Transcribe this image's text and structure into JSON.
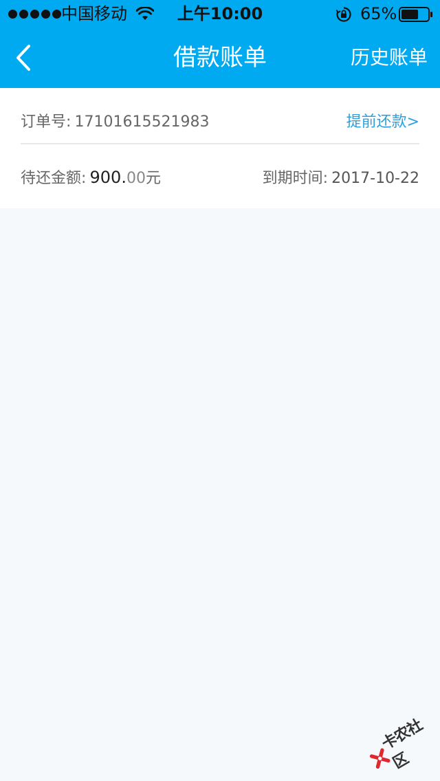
{
  "status_bar": {
    "carrier": "中国移动",
    "time": "上午10:00",
    "battery_percent": "65%",
    "battery_level": 0.65,
    "icons": [
      "signal-dots",
      "wifi-icon",
      "rotation-lock-icon",
      "battery-icon"
    ]
  },
  "nav": {
    "back_icon": "chevron-left-icon",
    "title": "借款账单",
    "history_label": "历史账单"
  },
  "bill": {
    "order_label": "订单号:",
    "order_number": "17101615521983",
    "prepay_label": "提前还款>",
    "amount_label": "待还金额:",
    "amount_integer": "900.",
    "amount_decimal": "00",
    "amount_unit": "元",
    "due_label": "到期时间:",
    "due_date": "2017-10-22"
  },
  "watermark": {
    "text": "卡农社区"
  },
  "colors": {
    "header": "#00aaf0",
    "link": "#2f9fdb",
    "background": "#f5f9fc"
  }
}
